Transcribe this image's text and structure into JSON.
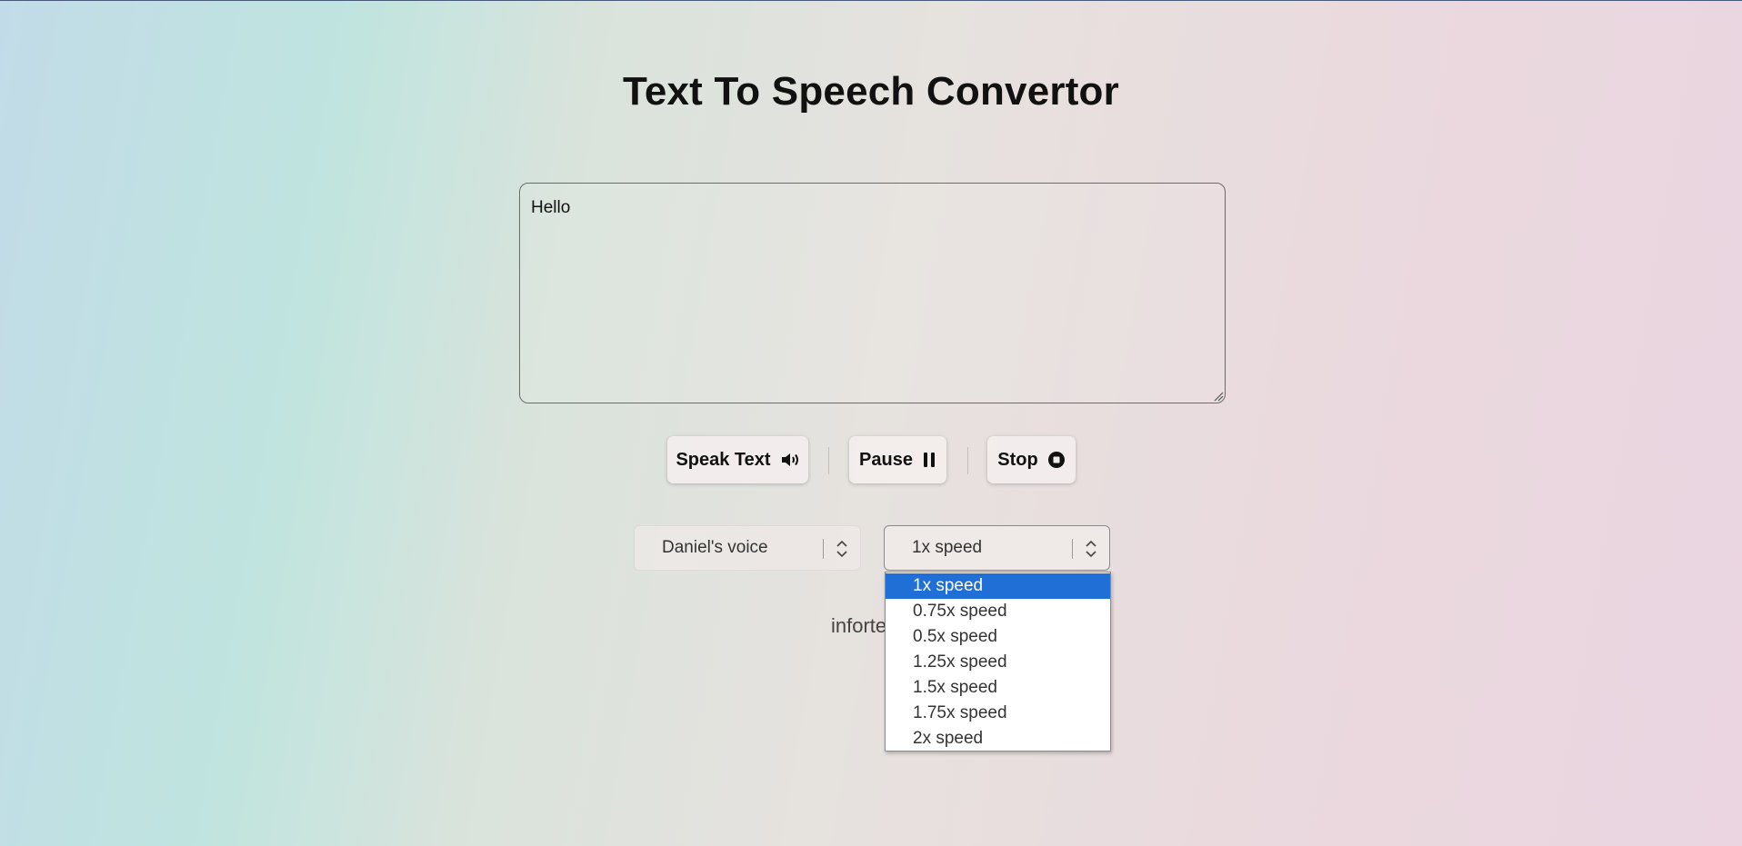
{
  "header": {
    "title": "Text To Speech Convertor"
  },
  "editor": {
    "value": "Hello"
  },
  "controls": {
    "speak_label": "Speak Text",
    "pause_label": "Pause",
    "stop_label": "Stop",
    "speak_icon": "speaker-icon",
    "pause_icon": "pause-icon",
    "stop_icon": "stop-circle-icon"
  },
  "voice_select": {
    "selected": "Daniel's voice"
  },
  "speed_select": {
    "selected": "1x speed",
    "options": [
      "1x speed",
      "0.75x speed",
      "0.5x speed",
      "1.25x speed",
      "1.5x speed",
      "1.75x speed",
      "2x speed"
    ]
  },
  "footer": {
    "text": "inforte"
  },
  "colors": {
    "selected_option_bg": "#1f6fd6",
    "title_text": "#111111"
  }
}
